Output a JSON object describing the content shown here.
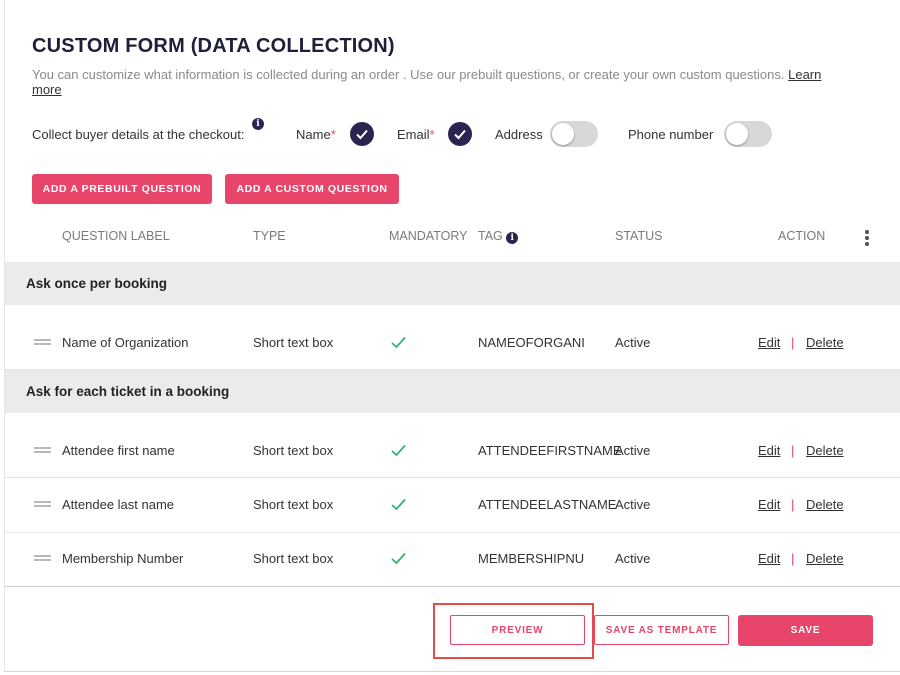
{
  "header": {
    "title": "CUSTOM FORM (DATA COLLECTION)",
    "description": "You can customize what information is collected during an order . Use our prebuilt questions, or create your own custom questions.",
    "learn_more": "Learn more"
  },
  "collect": {
    "label": "Collect buyer details at the checkout:",
    "info_glyph": "i",
    "fields": [
      {
        "label": "Name",
        "required_mark": "*",
        "enabled": true,
        "type": "check"
      },
      {
        "label": "Email",
        "required_mark": "*",
        "enabled": true,
        "type": "check"
      },
      {
        "label": "Address",
        "enabled": false,
        "type": "toggle"
      },
      {
        "label": "Phone number",
        "enabled": false,
        "type": "toggle"
      }
    ]
  },
  "actions": {
    "add_prebuilt": "ADD A PREBUILT QUESTION",
    "add_custom": "ADD A CUSTOM QUESTION"
  },
  "table": {
    "columns": [
      "QUESTION LABEL",
      "TYPE",
      "MANDATORY",
      "TAG",
      "STATUS",
      "ACTION"
    ],
    "groups": [
      {
        "title": "Ask once per booking",
        "rows": [
          {
            "label": "Name of Organization",
            "type": "Short text box",
            "mandatory": true,
            "tag": "NAMEOFORGANI",
            "status": "Active",
            "edit": "Edit",
            "sep": "|",
            "delete": "Delete"
          }
        ]
      },
      {
        "title": "Ask for each ticket in a booking",
        "rows": [
          {
            "label": "Attendee first name",
            "type": "Short text box",
            "mandatory": true,
            "tag": "ATTENDEEFIRSTNAME",
            "status": "Active",
            "edit": "Edit",
            "sep": "|",
            "delete": "Delete"
          },
          {
            "label": "Attendee last name",
            "type": "Short text box",
            "mandatory": true,
            "tag": "ATTENDEELASTNAME",
            "status": "Active",
            "edit": "Edit",
            "sep": "|",
            "delete": "Delete"
          },
          {
            "label": "Membership Number",
            "type": "Short text box",
            "mandatory": true,
            "tag": "MEMBERSHIPNU",
            "status": "Active",
            "edit": "Edit",
            "sep": "|",
            "delete": "Delete"
          }
        ]
      }
    ]
  },
  "footer": {
    "preview": "PREVIEW",
    "save_template": "SAVE AS TEMPLATE",
    "save": "SAVE"
  },
  "colors": {
    "accent": "#e8456a",
    "dark": "#2a2550",
    "highlight": "#e54b4b"
  }
}
